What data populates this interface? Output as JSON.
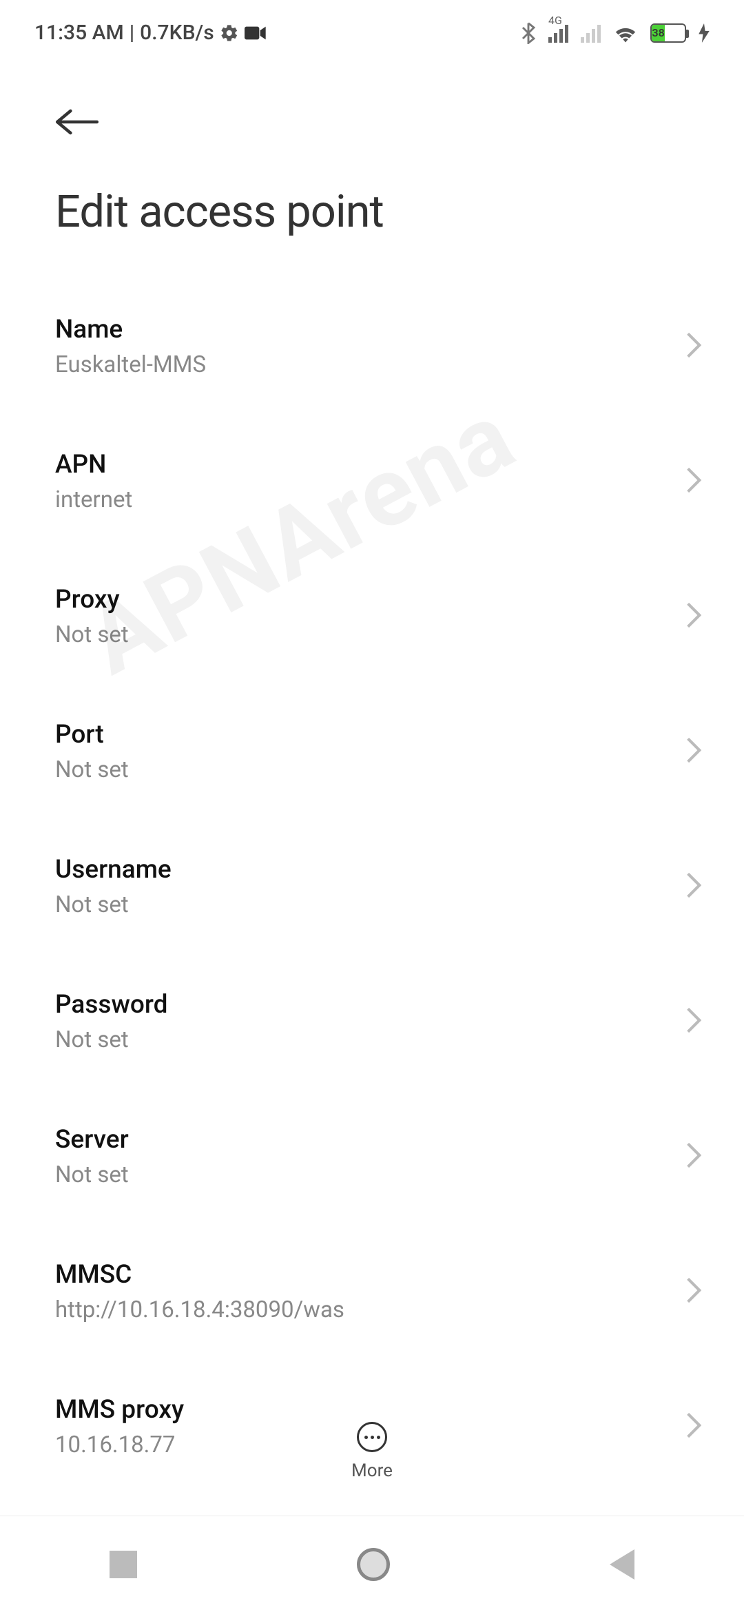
{
  "statusBar": {
    "time": "11:35 AM",
    "dataRate": "0.7KB/s",
    "networkLabel": "4G",
    "batteryPercent": "38"
  },
  "header": {
    "title": "Edit access point"
  },
  "rows": [
    {
      "title": "Name",
      "value": "Euskaltel-MMS"
    },
    {
      "title": "APN",
      "value": "internet"
    },
    {
      "title": "Proxy",
      "value": "Not set"
    },
    {
      "title": "Port",
      "value": "Not set"
    },
    {
      "title": "Username",
      "value": "Not set"
    },
    {
      "title": "Password",
      "value": "Not set"
    },
    {
      "title": "Server",
      "value": "Not set"
    },
    {
      "title": "MMSC",
      "value": "http://10.16.18.4:38090/was"
    },
    {
      "title": "MMS proxy",
      "value": "10.16.18.77"
    }
  ],
  "moreLabel": "More",
  "watermark": "APNArena"
}
